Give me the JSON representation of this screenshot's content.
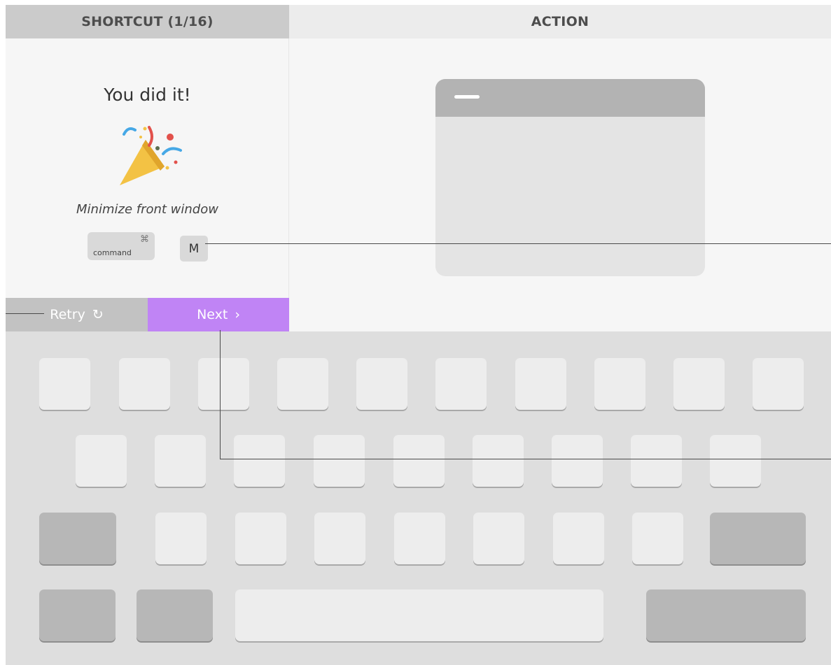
{
  "tabs": {
    "shortcut": "SHORTCUT (1/16)",
    "action": "ACTION"
  },
  "lesson": {
    "title": "You did it!",
    "description": "Minimize front window",
    "keys": {
      "modifier_label": "command",
      "modifier_symbol": "⌘",
      "letter": "M"
    }
  },
  "buttons": {
    "retry_label": "Retry",
    "retry_icon": "↻",
    "next_label": "Next",
    "next_icon": "›"
  },
  "colors": {
    "accent": "#c084f5",
    "retry": "#c2c2c2",
    "tab_active": "#cbcbcb"
  }
}
